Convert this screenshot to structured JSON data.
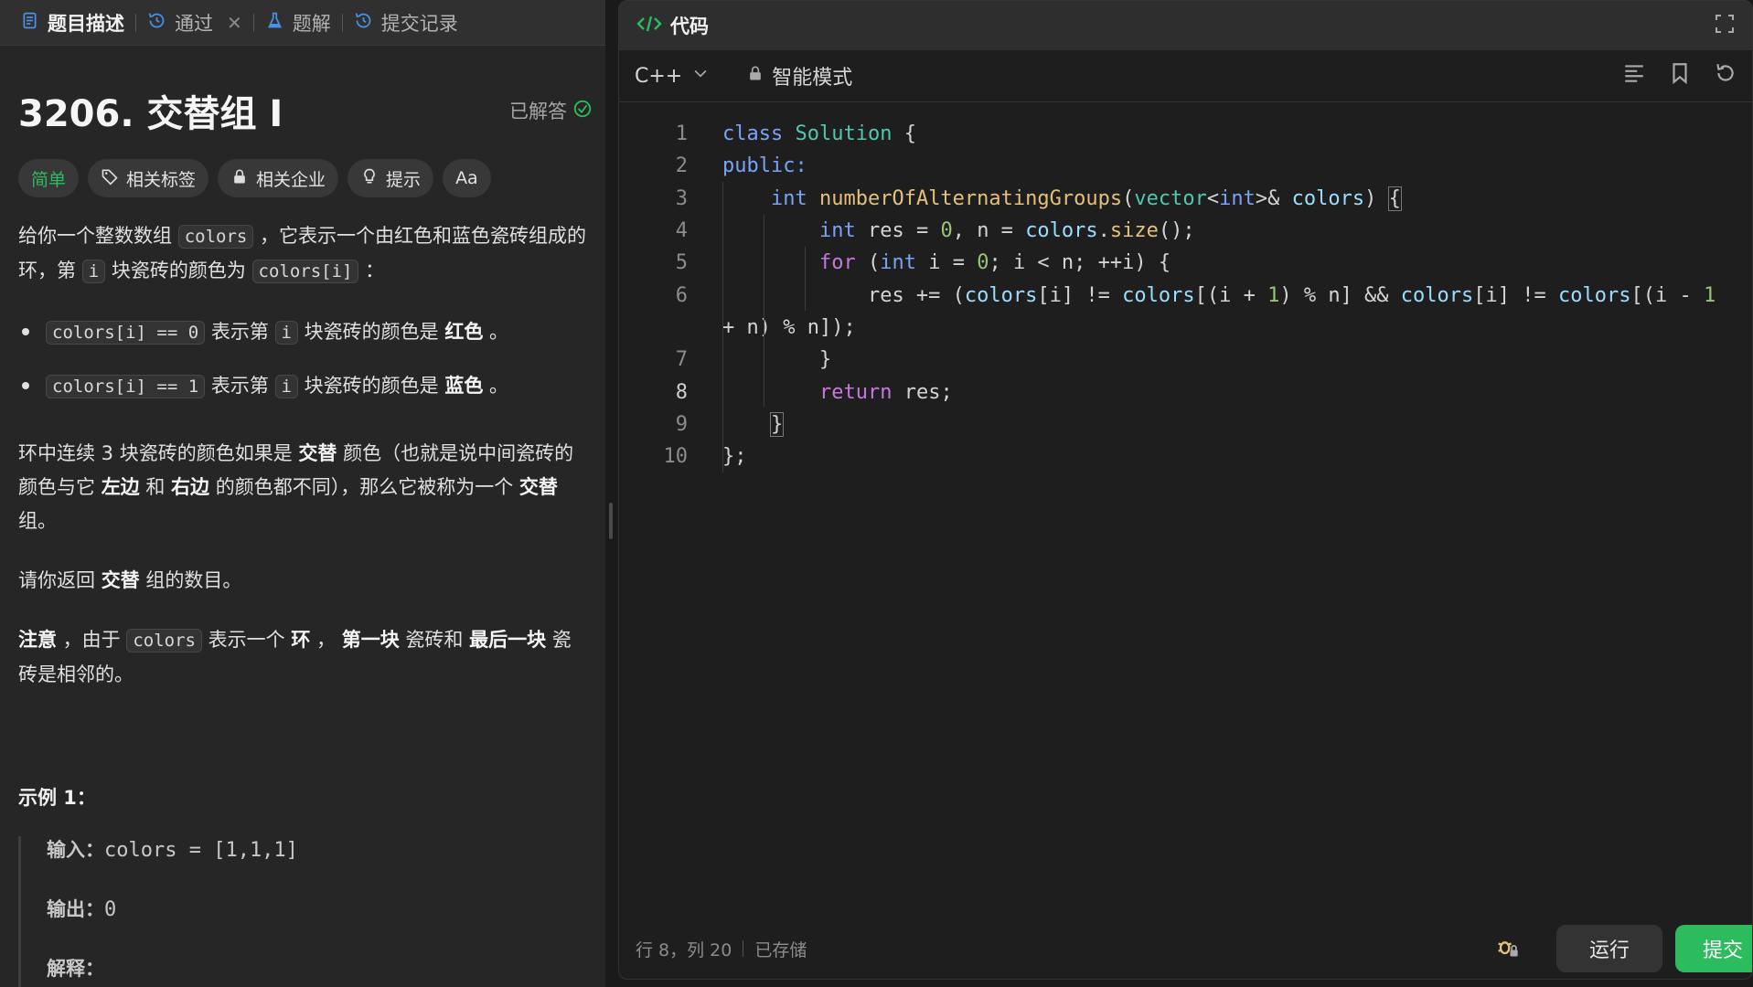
{
  "left": {
    "tabs": [
      {
        "label": "题目描述"
      },
      {
        "label": "通过"
      },
      {
        "label": "题解"
      },
      {
        "label": "提交记录"
      }
    ],
    "title": "3206. 交替组 I",
    "solved": "已解答",
    "tags": {
      "difficulty": "简单",
      "related_tags": "相关标签",
      "companies": "相关企业",
      "hint": "提示",
      "font": "Aa"
    },
    "desc": {
      "p1_a": "给你一个整数数组 ",
      "p1_code1": "colors",
      "p1_b": " ，它表示一个由红色和蓝色瓷砖组成的环，第 ",
      "p1_code2": "i",
      "p1_c": " 块瓷砖的颜色为 ",
      "p1_code3": "colors[i]",
      "p1_d": " ：",
      "b1_code": "colors[i] == 0",
      "b1_a": " 表示第 ",
      "b1_code2": "i",
      "b1_b": " 块瓷砖的颜色是 ",
      "b1_bold": "红色",
      "b1_c": " 。",
      "b2_code": "colors[i] == 1",
      "b2_a": " 表示第 ",
      "b2_code2": "i",
      "b2_b": " 块瓷砖的颜色是 ",
      "b2_bold": "蓝色",
      "b2_c": " 。",
      "p2_a": "环中连续 3 块瓷砖的颜色如果是 ",
      "p2_b1": "交替",
      "p2_b": " 颜色（也就是说中间瓷砖的颜色与它 ",
      "p2_b2": "左边",
      "p2_c": " 和 ",
      "p2_b3": "右边",
      "p2_d": " 的颜色都不同），那么它被称为一个 ",
      "p2_b4": "交替",
      "p2_e": " 组。",
      "p3_a": "请你返回 ",
      "p3_b": "交替",
      "p3_c": " 组的数目。",
      "p4_b1": "注意",
      "p4_a": " ，由于 ",
      "p4_code": "colors",
      "p4_b": " 表示一个 ",
      "p4_b2": "环",
      "p4_c": " ， ",
      "p4_b3": "第一块",
      "p4_d": " 瓷砖和 ",
      "p4_b4": "最后一块",
      "p4_e": " 瓷砖是相邻的。"
    },
    "example": {
      "title": "示例 1：",
      "input_label": "输入：",
      "input_value": "colors = [1,1,1]",
      "output_label": "输出：",
      "output_value": "0",
      "explain_label": "解释："
    }
  },
  "right": {
    "header_title": "代码",
    "language": "C++",
    "mode": "智能模式",
    "code_lines": [
      {
        "n": "1"
      },
      {
        "n": "2"
      },
      {
        "n": "3"
      },
      {
        "n": "4"
      },
      {
        "n": "5"
      },
      {
        "n": "6"
      },
      {
        "n": ""
      },
      {
        "n": "7"
      },
      {
        "n": "8"
      },
      {
        "n": "9"
      },
      {
        "n": "10"
      }
    ],
    "status": {
      "position": "行 8，列 20",
      "saved": "已存储"
    },
    "run_label": "运行",
    "submit_label": "提交"
  }
}
